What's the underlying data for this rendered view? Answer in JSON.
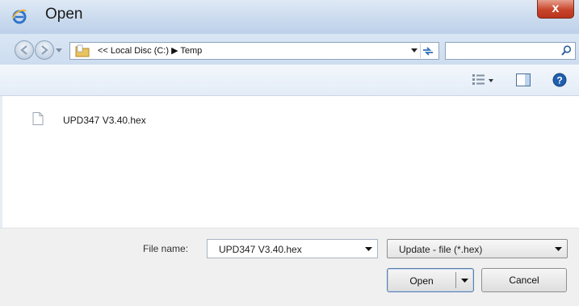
{
  "window": {
    "title": "Open",
    "close_label": "x"
  },
  "address": {
    "breadcrumb": "<< Local Disc (C:) ▶ Temp",
    "search_placeholder": ""
  },
  "files": [
    {
      "name": "UPD347 V3.40.hex"
    }
  ],
  "footer": {
    "file_name_label": "File name:",
    "file_name_value": "UPD347 V3.40.hex",
    "file_type": "Update - file (*.hex)",
    "open_label": "Open",
    "cancel_label": "Cancel"
  },
  "icons": {
    "app": "ie-icon",
    "back": "back-arrow-icon",
    "forward": "forward-arrow-icon",
    "folder": "folder-icon",
    "refresh": "refresh-icon",
    "search": "search-icon",
    "views": "views-icon",
    "preview_pane": "preview-pane-icon",
    "help": "help-icon",
    "file": "document-icon"
  },
  "colors": {
    "close_button": "#c8452c",
    "chrome": "#cddcef",
    "help": "#1f5fae"
  }
}
